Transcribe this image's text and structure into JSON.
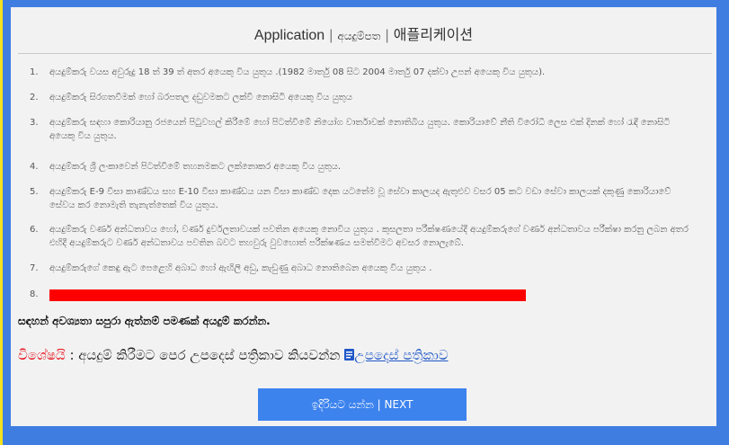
{
  "application": {
    "title": {
      "english": "Application",
      "separator": "|",
      "sinhala": "අයදුම්පත",
      "korean": "애플리케이션"
    },
    "requirements": [
      {
        "number": "1.",
        "text": "අයදුම්කරු වයස අවුරුදු 18 ත් 39 ත් අතර අයෙකු විය යුතුය .(1982 මාර්තු 08 සිට 2004 මාර්තු 07 දක්වා උපන් අයෙකු විය යුතුය)."
      },
      {
        "number": "2.",
        "text": "අයදුම්කරු සිරගතවීමක් හෝ බරපතල දඩුවමකට ලක්වී නොසිටි අයෙකු විය යුතුය"
      },
      {
        "number": "3.",
        "text": "අයදුම්කරු සඳහා කොරියානු රජයෙන් පිටුවහල් කිරීමේ හෝ පිටත්වීමේ නියෝග වාර්තාවක් නොතිබිය යුතුය. කොරියාවේ නීති විරෝධී ලෙස එක් දිනක් හෝ රැඳී නොසිටි අයෙකු විය යුතුය."
      },
      {
        "number": "4.",
        "text": "අයදුම්කරු ශ්‍රී ලංකාවෙන් පිටත්වීමේ තහනමකට ලක්නොකර අයෙකු විය යුතුය."
      },
      {
        "number": "5.",
        "text": "අයදුම්කරු E-9 වීසා කාණ්ඩය සහ E-10 වීසා කාණ්ඩය යන වීසා කාණ්ඩ දෙක යටතේම වූ සේවා කාලයද ඇතුළුව වසර 05 කට වඩා සේවා කාලයක් දකුණු කොරියාවේ සේවය කර නොමැති තැනැත්තෙක් විය යුතුය."
      },
      {
        "number": "6.",
        "text": "අයදුම්කරු වර්ණ අන්ධතාවය හෝ, වර්ණ දුර්වලතාවයක් පවතින අයෙකු නොවිය යුතුය . කුසලතා පරීක්ෂණයේදී අයදුම්කරුගේ වර්ණ අන්ධතාවය පරීක්ෂා කරනු ලබන අතර එහිදී අයදුම්කරුට වර්ණ අන්ධතාවය පවතින බවට තහවුරු වුවහොත් පරීක්ෂණය සමත්වීමට අවසර නොලැබේ."
      },
      {
        "number": "7.",
        "text": "අයදුම්කරුගේ කෙඳු ඇට පෙළෙහි අබාධ හෝ ඇඟිලි අඩු, කැඩුණු අබාධ නොතිබෙන අයෙකු විය යුතුය ."
      },
      {
        "number": "8.",
        "redacted": true
      }
    ],
    "notice": "සඳහන් අවශ්‍යතා සපුරා ඇත්නම් පමණක් අයදුම් කරන්න.",
    "special": {
      "label": "විශේෂයි",
      "separator": ":",
      "text": "අයදුම් කිරීමට පෙර උපදෙස් පත්‍රිකාව කියවන්න",
      "link_icon": "document-icon",
      "link_text": "උපදෙස් පත්‍රිකාව"
    },
    "next_button": "ඉදිරියට යන්න | NEXT"
  },
  "colors": {
    "frame": "#3f7ee0",
    "stripe": "#f4e21c",
    "panel": "#f2f2f2",
    "button": "#3c83ee",
    "redaction": "#ff0000",
    "special_label": "#e8101a",
    "link": "#1f57c8"
  }
}
